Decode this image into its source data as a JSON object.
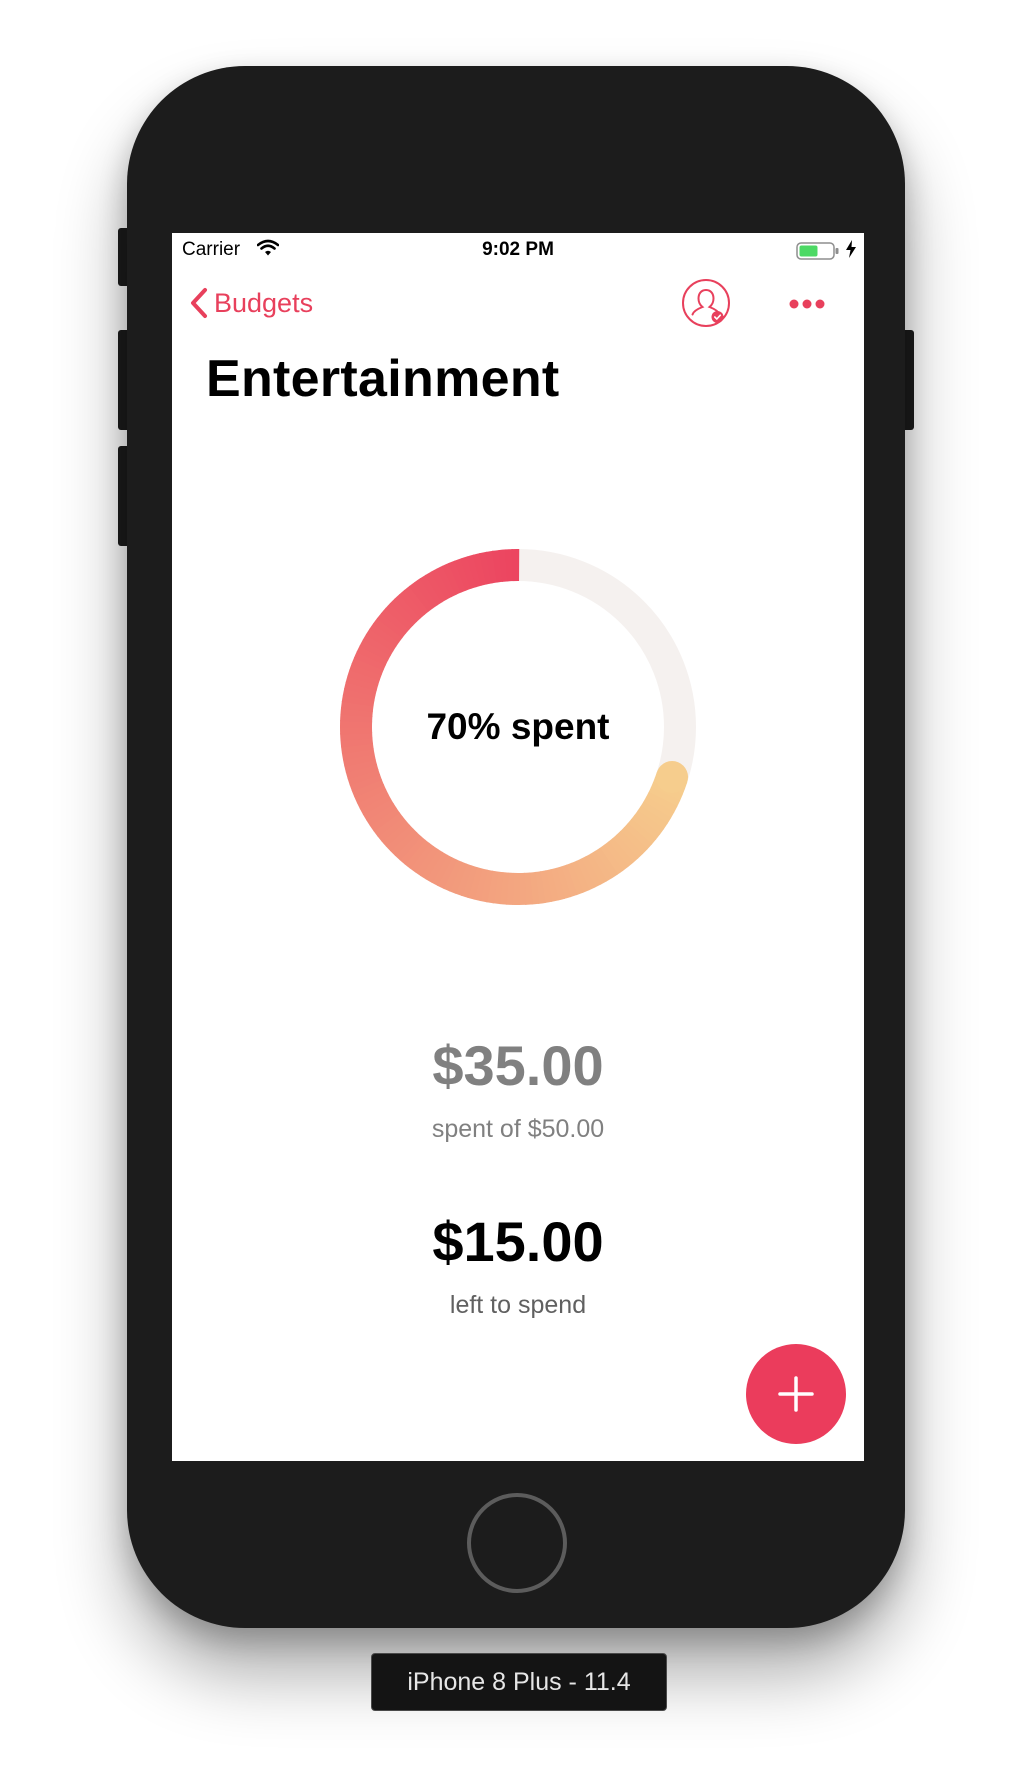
{
  "status_bar": {
    "carrier": "Carrier",
    "time": "9:02 PM",
    "wifi_icon": "wifi-icon",
    "battery_icon": "battery-charging-icon"
  },
  "nav": {
    "back_label": "Budgets",
    "back_icon": "chevron-left-icon",
    "profile_icon": "profile-check-icon",
    "more_icon": "more-dots-icon"
  },
  "budget": {
    "title": "Entertainment",
    "progress_fraction": 0.7,
    "progress_label": "70% spent",
    "spent_amount": "$35.00",
    "spent_caption": "spent of $50.00",
    "left_amount": "$15.00",
    "left_caption": "left to spend"
  },
  "fab": {
    "icon": "plus-icon"
  },
  "device_label": "iPhone 8 Plus - 11.4",
  "colors": {
    "accent": "#e8405c",
    "ring_start": "#f6cd8d",
    "ring_end": "#ec4560",
    "ring_track": "#f5f1ef",
    "device_body": "#1c1c1c"
  }
}
